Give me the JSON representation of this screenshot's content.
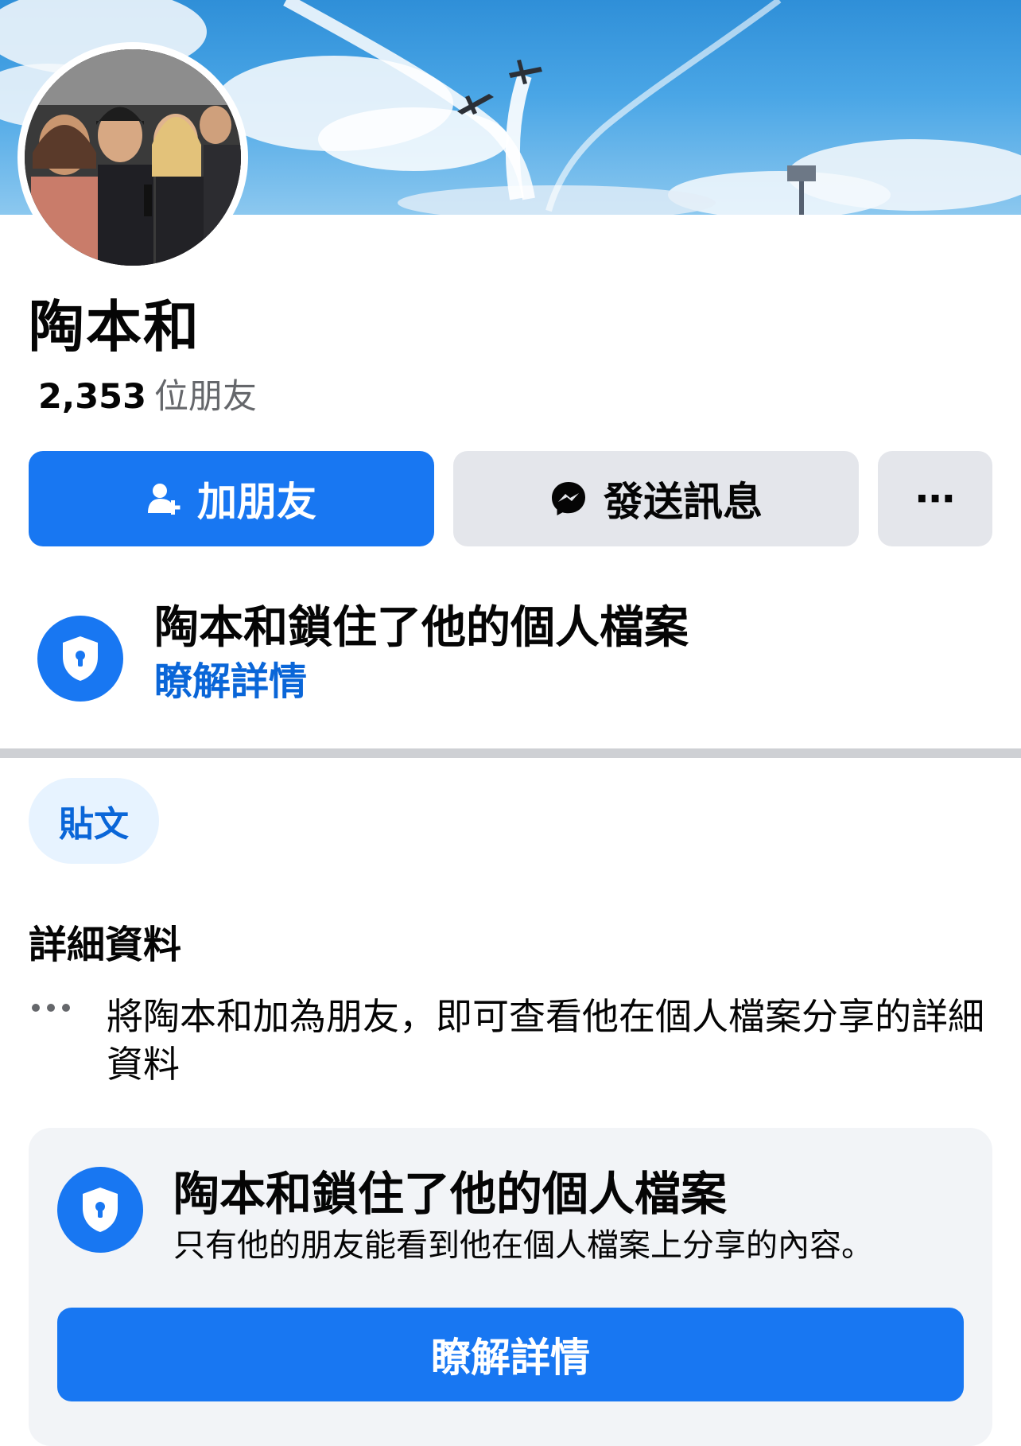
{
  "profile": {
    "name": "陶本和",
    "friends_count": "2,353",
    "friends_label": "位朋友"
  },
  "actions": {
    "add_friend": "加朋友",
    "send_message": "發送訊息",
    "more": "⋯"
  },
  "lock_notice": {
    "title": "陶本和鎖住了他的個人檔案",
    "link": "瞭解詳情"
  },
  "tabs": {
    "posts": "貼文"
  },
  "details": {
    "title": "詳細資料",
    "text": "將陶本和加為朋友，即可查看他在個人檔案分享的詳細資料"
  },
  "lock_card": {
    "title": "陶本和鎖住了他的個人檔案",
    "subtitle": "只有他的朋友能看到他在個人檔案上分享的內容。",
    "button": "瞭解詳情"
  },
  "colors": {
    "primary": "#1877f2",
    "link": "#0a66d8",
    "secondary_button": "#e4e6eb",
    "chip_bg": "#e7f3ff",
    "card_bg": "#f2f4f7",
    "muted_text": "#65676b"
  },
  "icons": {
    "add_friend": "person-plus-icon",
    "message": "messenger-icon",
    "lock": "shield-lock-icon",
    "details": "ellipsis-icon"
  }
}
